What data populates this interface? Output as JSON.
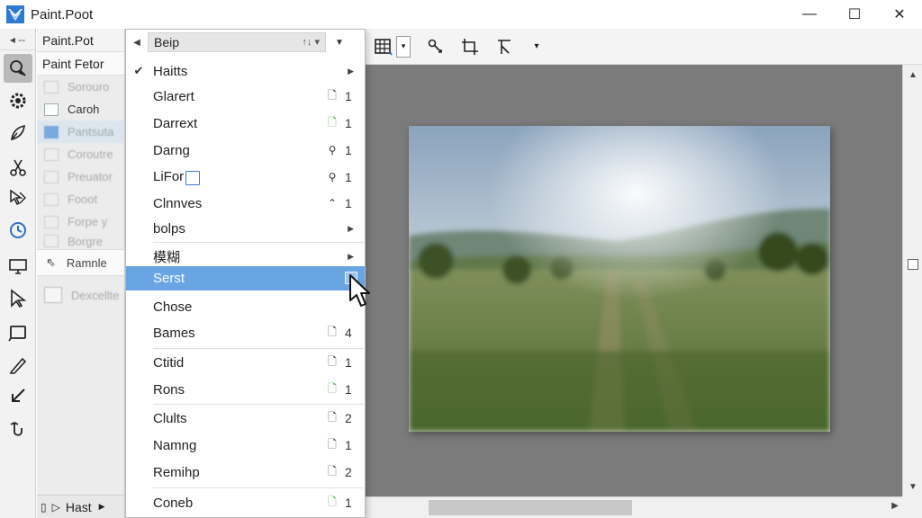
{
  "window": {
    "title": "Paint.Poot",
    "minimize": "—",
    "maximize": "☐",
    "close": "✕"
  },
  "colors": {
    "accent": "#6aa5e3",
    "canvas_bg": "#7b7b7b"
  },
  "toolcol": {
    "top_label": "◂ --",
    "tools": [
      "magnify-icon",
      "gear-icon",
      "pen-icon",
      "scissors-icon",
      "select-icon",
      "clock-icon",
      "monitor-icon",
      "lasso-icon",
      "rectangle-icon",
      "pencil-icon",
      "arrow-icon",
      "hook-icon"
    ]
  },
  "sidepanel": {
    "header": "Paint.Pot",
    "subheader": "Paint Fetor",
    "items": [
      {
        "label": "Sorouro",
        "state": "faded"
      },
      {
        "label": "Caroh",
        "state": "normal"
      },
      {
        "label": "Pantsuta",
        "state": "sel"
      },
      {
        "label": "Coroutre",
        "state": "faded"
      },
      {
        "label": "Preuator",
        "state": "faded"
      },
      {
        "label": "Fooot",
        "state": "faded"
      },
      {
        "label": "Forpe y",
        "state": "faded"
      },
      {
        "label": "Borgre",
        "state": "faded"
      }
    ],
    "cursor_row": "Ramnle",
    "extra_item": "Dexcellte",
    "bottom_label": "Hast"
  },
  "menu": {
    "header_value": "Beip",
    "header_ctrl": "↑↓ ▾",
    "items": [
      {
        "label": "Haitts",
        "check": "✔",
        "arrow": true
      },
      {
        "label": "Glarert",
        "shortcut": "🗋",
        "num": "1"
      },
      {
        "label": "Darrext",
        "shortcut": "🗋",
        "num": "1"
      },
      {
        "label": "Darng",
        "shortcut": "⚲",
        "num": "1"
      },
      {
        "label": "LiFor",
        "shortcut": "⚲",
        "num": "1",
        "box_icon": true
      },
      {
        "label": "Clnnves",
        "shortcut": "⌃",
        "num": "1"
      },
      {
        "label": "bolps",
        "arrow": true
      },
      {
        "label": "模糊",
        "arrow": true
      },
      {
        "label": "Serst",
        "highlighted": true
      },
      {
        "label": "Chose"
      },
      {
        "label": "Bames",
        "shortcut": "🗋",
        "num": "4"
      },
      {
        "label": "Ctitid",
        "shortcut": "🗋",
        "num": "1"
      },
      {
        "label": "Rons",
        "shortcut": "🗋",
        "num": "1"
      },
      {
        "label": "Clults",
        "shortcut": "🗋",
        "num": "2"
      },
      {
        "label": "Namng",
        "shortcut": "🗋",
        "num": "1"
      },
      {
        "label": "Remihp",
        "shortcut": "🗋",
        "num": "2"
      },
      {
        "label": "Coneb",
        "shortcut": "🗋",
        "num": "1"
      }
    ]
  }
}
